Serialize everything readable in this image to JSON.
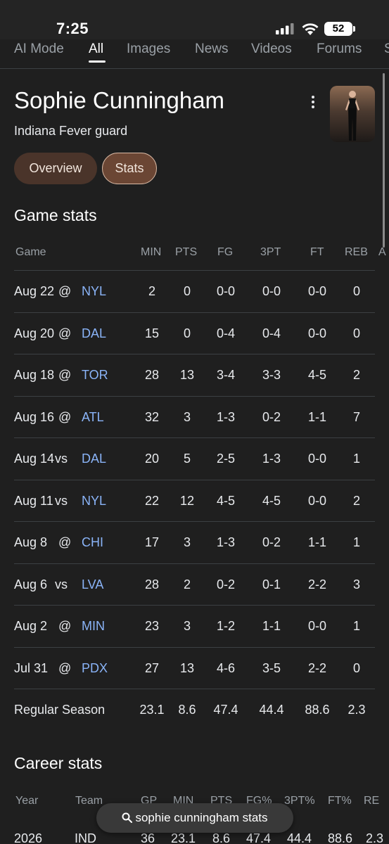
{
  "status": {
    "time": "7:25",
    "battery": "52"
  },
  "tabs": [
    "AI Mode",
    "All",
    "Images",
    "News",
    "Videos",
    "Forums",
    "S"
  ],
  "entity": {
    "name": "Sophie Cunningham",
    "description": "Indiana Fever guard"
  },
  "chips": {
    "overview": "Overview",
    "stats": "Stats"
  },
  "game_stats": {
    "title": "Game stats",
    "headers": [
      "Game",
      "MIN",
      "PTS",
      "FG",
      "3PT",
      "FT",
      "REB",
      "A"
    ],
    "rows": [
      {
        "date": "Aug 22",
        "loc": "@",
        "team": "NYL",
        "min": "2",
        "pts": "0",
        "fg": "0-0",
        "tp": "0-0",
        "ft": "0-0",
        "reb": "0"
      },
      {
        "date": "Aug 20",
        "loc": "@",
        "team": "DAL",
        "min": "15",
        "pts": "0",
        "fg": "0-4",
        "tp": "0-4",
        "ft": "0-0",
        "reb": "0"
      },
      {
        "date": "Aug 18",
        "loc": "@",
        "team": "TOR",
        "min": "28",
        "pts": "13",
        "fg": "3-4",
        "tp": "3-3",
        "ft": "4-5",
        "reb": "2"
      },
      {
        "date": "Aug 16",
        "loc": "@",
        "team": "ATL",
        "min": "32",
        "pts": "3",
        "fg": "1-3",
        "tp": "0-2",
        "ft": "1-1",
        "reb": "7"
      },
      {
        "date": "Aug 14",
        "loc": "vs",
        "team": "DAL",
        "min": "20",
        "pts": "5",
        "fg": "2-5",
        "tp": "1-3",
        "ft": "0-0",
        "reb": "1"
      },
      {
        "date": "Aug 11",
        "loc": "vs",
        "team": "NYL",
        "min": "22",
        "pts": "12",
        "fg": "4-5",
        "tp": "4-5",
        "ft": "0-0",
        "reb": "2"
      },
      {
        "date": "Aug 8",
        "loc": "@",
        "team": "CHI",
        "min": "17",
        "pts": "3",
        "fg": "1-3",
        "tp": "0-2",
        "ft": "1-1",
        "reb": "1"
      },
      {
        "date": "Aug 6",
        "loc": "vs",
        "team": "LVA",
        "min": "28",
        "pts": "2",
        "fg": "0-2",
        "tp": "0-1",
        "ft": "2-2",
        "reb": "3"
      },
      {
        "date": "Aug 2",
        "loc": "@",
        "team": "MIN",
        "min": "23",
        "pts": "3",
        "fg": "1-2",
        "tp": "1-1",
        "ft": "0-0",
        "reb": "1"
      },
      {
        "date": "Jul 31",
        "loc": "@",
        "team": "PDX",
        "min": "27",
        "pts": "13",
        "fg": "4-6",
        "tp": "3-5",
        "ft": "2-2",
        "reb": "0"
      }
    ],
    "season": {
      "label": "Regular Season",
      "min": "23.1",
      "pts": "8.6",
      "fg": "47.4",
      "tp": "44.4",
      "ft": "88.6",
      "reb": "2.3"
    }
  },
  "career_stats": {
    "title": "Career stats",
    "headers": [
      "Year",
      "Team",
      "GP",
      "MIN",
      "PTS",
      "FG%",
      "3PT%",
      "FT%",
      "RE"
    ],
    "rows": [
      {
        "year": "2026",
        "team": "IND",
        "gp": "36",
        "min": "23.1",
        "pts": "8.6",
        "fg": "47.4",
        "tp": "44.4",
        "ft": "88.6",
        "re": "2.3"
      }
    ]
  },
  "search_pill": "sophie cunningham stats"
}
